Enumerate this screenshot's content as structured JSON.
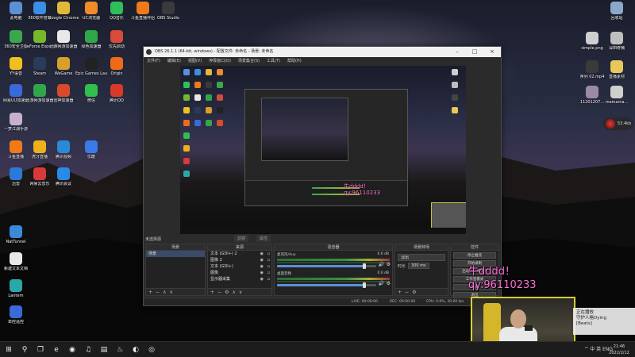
{
  "desktop": {
    "left_icons": [
      {
        "label": "此电脑",
        "icon": "computer-icon",
        "color": "#5c8fd6"
      },
      {
        "label": "360软件管家",
        "icon": "360-manager-icon",
        "color": "#3a8ee6"
      },
      {
        "label": "Google Chrome",
        "icon": "chrome-icon",
        "color": "#e0b83a"
      },
      {
        "label": "UC浏览器",
        "icon": "uc-browser-icon",
        "color": "#f08a2a"
      },
      {
        "label": "QQ音乐",
        "icon": "qq-music-icon",
        "color": "#2fbf5a"
      },
      {
        "label": "斗鱼直播伴侣",
        "icon": "douyu-icon",
        "color": "#f07a1a"
      },
      {
        "label": "OBS Studio",
        "icon": "obs-icon",
        "color": "#3a3a3a"
      },
      {
        "label": "360安全卫士",
        "icon": "360-safe-icon",
        "color": "#3aa84a"
      },
      {
        "label": "GeForce Experience",
        "icon": "geforce-icon",
        "color": "#76b82a"
      },
      {
        "label": "迅游网游加速器",
        "icon": "xunyou-icon",
        "color": "#e8e8e8"
      },
      {
        "label": "绿色加速器",
        "icon": "green-booster-icon",
        "color": "#2fa84a"
      },
      {
        "label": "优先启动",
        "icon": "launcher-icon",
        "color": "#d84a3a"
      },
      {
        "label": "YY语音",
        "icon": "yy-icon",
        "color": "#f0c020"
      },
      {
        "label": "Steam",
        "icon": "steam-icon",
        "color": "#2a3a5a"
      },
      {
        "label": "WeGame",
        "icon": "wegame-icon",
        "color": "#d8a02a"
      },
      {
        "label": "Epic Games Launcher",
        "icon": "epic-icon",
        "color": "#222222"
      },
      {
        "label": "Origin",
        "icon": "origin-icon",
        "color": "#f06a1a"
      },
      {
        "label": "网易UU加速器",
        "icon": "uu-icon",
        "color": "#3a6ad8"
      },
      {
        "label": "迅游网游加速器",
        "icon": "xunyou2-icon",
        "color": "#2fa84a"
      },
      {
        "label": "雷神加速器",
        "icon": "leishen-icon",
        "color": "#d84a2a"
      },
      {
        "label": "微信",
        "icon": "wechat-icon",
        "color": "#2fbf4a"
      },
      {
        "label": "腾讯QQ",
        "icon": "qq-icon",
        "color": "#d83a2a"
      },
      {
        "label": "一梦江湖手游",
        "icon": "game-icon",
        "color": "#c8b0d0"
      },
      {
        "label": "斗鱼直播",
        "icon": "douyu2-icon",
        "color": "#f07a1a"
      },
      {
        "label": "虎牙直播",
        "icon": "huya-icon",
        "color": "#f0b01a"
      },
      {
        "label": "腾讯视频",
        "icon": "tencent-video-icon",
        "color": "#2a8ad8"
      },
      {
        "label": "优酷",
        "icon": "youku-icon",
        "color": "#3a7ae8"
      },
      {
        "label": "迅雷",
        "icon": "xunlei-icon",
        "color": "#2a7ad8"
      },
      {
        "label": "网易云音乐",
        "icon": "netease-music-icon",
        "color": "#d83a3a"
      },
      {
        "label": "腾讯会议",
        "icon": "tencent-meeting-icon",
        "color": "#2a8ae8"
      },
      {
        "label": "NatTunnel",
        "icon": "nattunnel-icon",
        "color": "#3a8ad8"
      },
      {
        "label": "新建文本文档",
        "icon": "text-doc-icon",
        "color": "#e8e8e8"
      },
      {
        "label": "Lantern",
        "icon": "lantern-icon",
        "color": "#2aa8a8"
      },
      {
        "label": "单控遥控",
        "icon": "remote-icon",
        "color": "#3a6ad8"
      }
    ],
    "right_icons": [
      {
        "label": "回收站",
        "icon": "recycle-bin-icon",
        "color": "#8aa8c8"
      },
      {
        "label": "simple.png",
        "icon": "image-file-icon",
        "color": "#cfcfcf"
      },
      {
        "label": "深田奇楠",
        "icon": "image-file-icon",
        "color": "#bfbfbf"
      },
      {
        "label": "序列 02.mp4",
        "icon": "video-file-icon",
        "color": "#3a3a3a"
      },
      {
        "label": "直播素材",
        "icon": "folder-icon",
        "color": "#e8c85a"
      },
      {
        "label": "11201207...",
        "icon": "image-file-icon",
        "color": "#9a8aa8"
      },
      {
        "label": "mamama...",
        "icon": "image-file-icon",
        "color": "#cfcfcf"
      }
    ],
    "badge_text": "53.4kb"
  },
  "obs": {
    "title": "OBS 26.1.1 (64-bit, windows) - 配置文件: 未命名 - 场景: 未命名",
    "menu": [
      "文件(F)",
      "编辑(E)",
      "视图(V)",
      "停靠窗口(D)",
      "场景集合(S)",
      "工具(T)",
      "帮助(H)"
    ],
    "no_source_label": "未选择源",
    "filters_label": "滤镜",
    "properties_label": "属性",
    "preview_overlay_text": "牛dddd！\nqy:96110233",
    "docks": {
      "scenes": {
        "title": "场景",
        "items": [
          {
            "label": "场景",
            "selected": true
          }
        ]
      },
      "sources": {
        "title": "来源",
        "items": [
          {
            "label": "文本 (GDI+) 2"
          },
          {
            "label": "图像 2"
          },
          {
            "label": "文本 (GDI+)"
          },
          {
            "label": "图像"
          },
          {
            "label": "显示器采集"
          }
        ]
      },
      "mixer": {
        "title": "混音器",
        "tracks": [
          {
            "name": "麦克风/Aux",
            "db": "0.0 dB",
            "volume": 0.88
          },
          {
            "name": "桌面音频",
            "db": "0.0 dB",
            "volume": 0.88
          }
        ]
      },
      "transitions": {
        "title": "场景转场",
        "selected": "淡出",
        "duration_label": "时长",
        "duration_value": "300 ms"
      },
      "controls": {
        "title": "控件",
        "buttons": [
          "停止推流",
          "开始录制",
          "启动虚拟摄像机",
          "工作室模式",
          "设置",
          "退出"
        ]
      }
    },
    "status": {
      "live": "LIVE: 00:00:00",
      "rec": "REC: 00:00:00",
      "cpu": "CPU: 0.6%, 30.00 fps",
      "kbps": "kb/s: 0"
    }
  },
  "stream_overlay": {
    "text_line1": "牛dddd！",
    "text_line2": "qy:96110233"
  },
  "notification": {
    "text": "正在播放\n守护人格Dying\n[Beats]"
  },
  "taskbar": {
    "tray": "^ 中 英 ENG",
    "time": "21:46",
    "date": "2022/2/12"
  }
}
